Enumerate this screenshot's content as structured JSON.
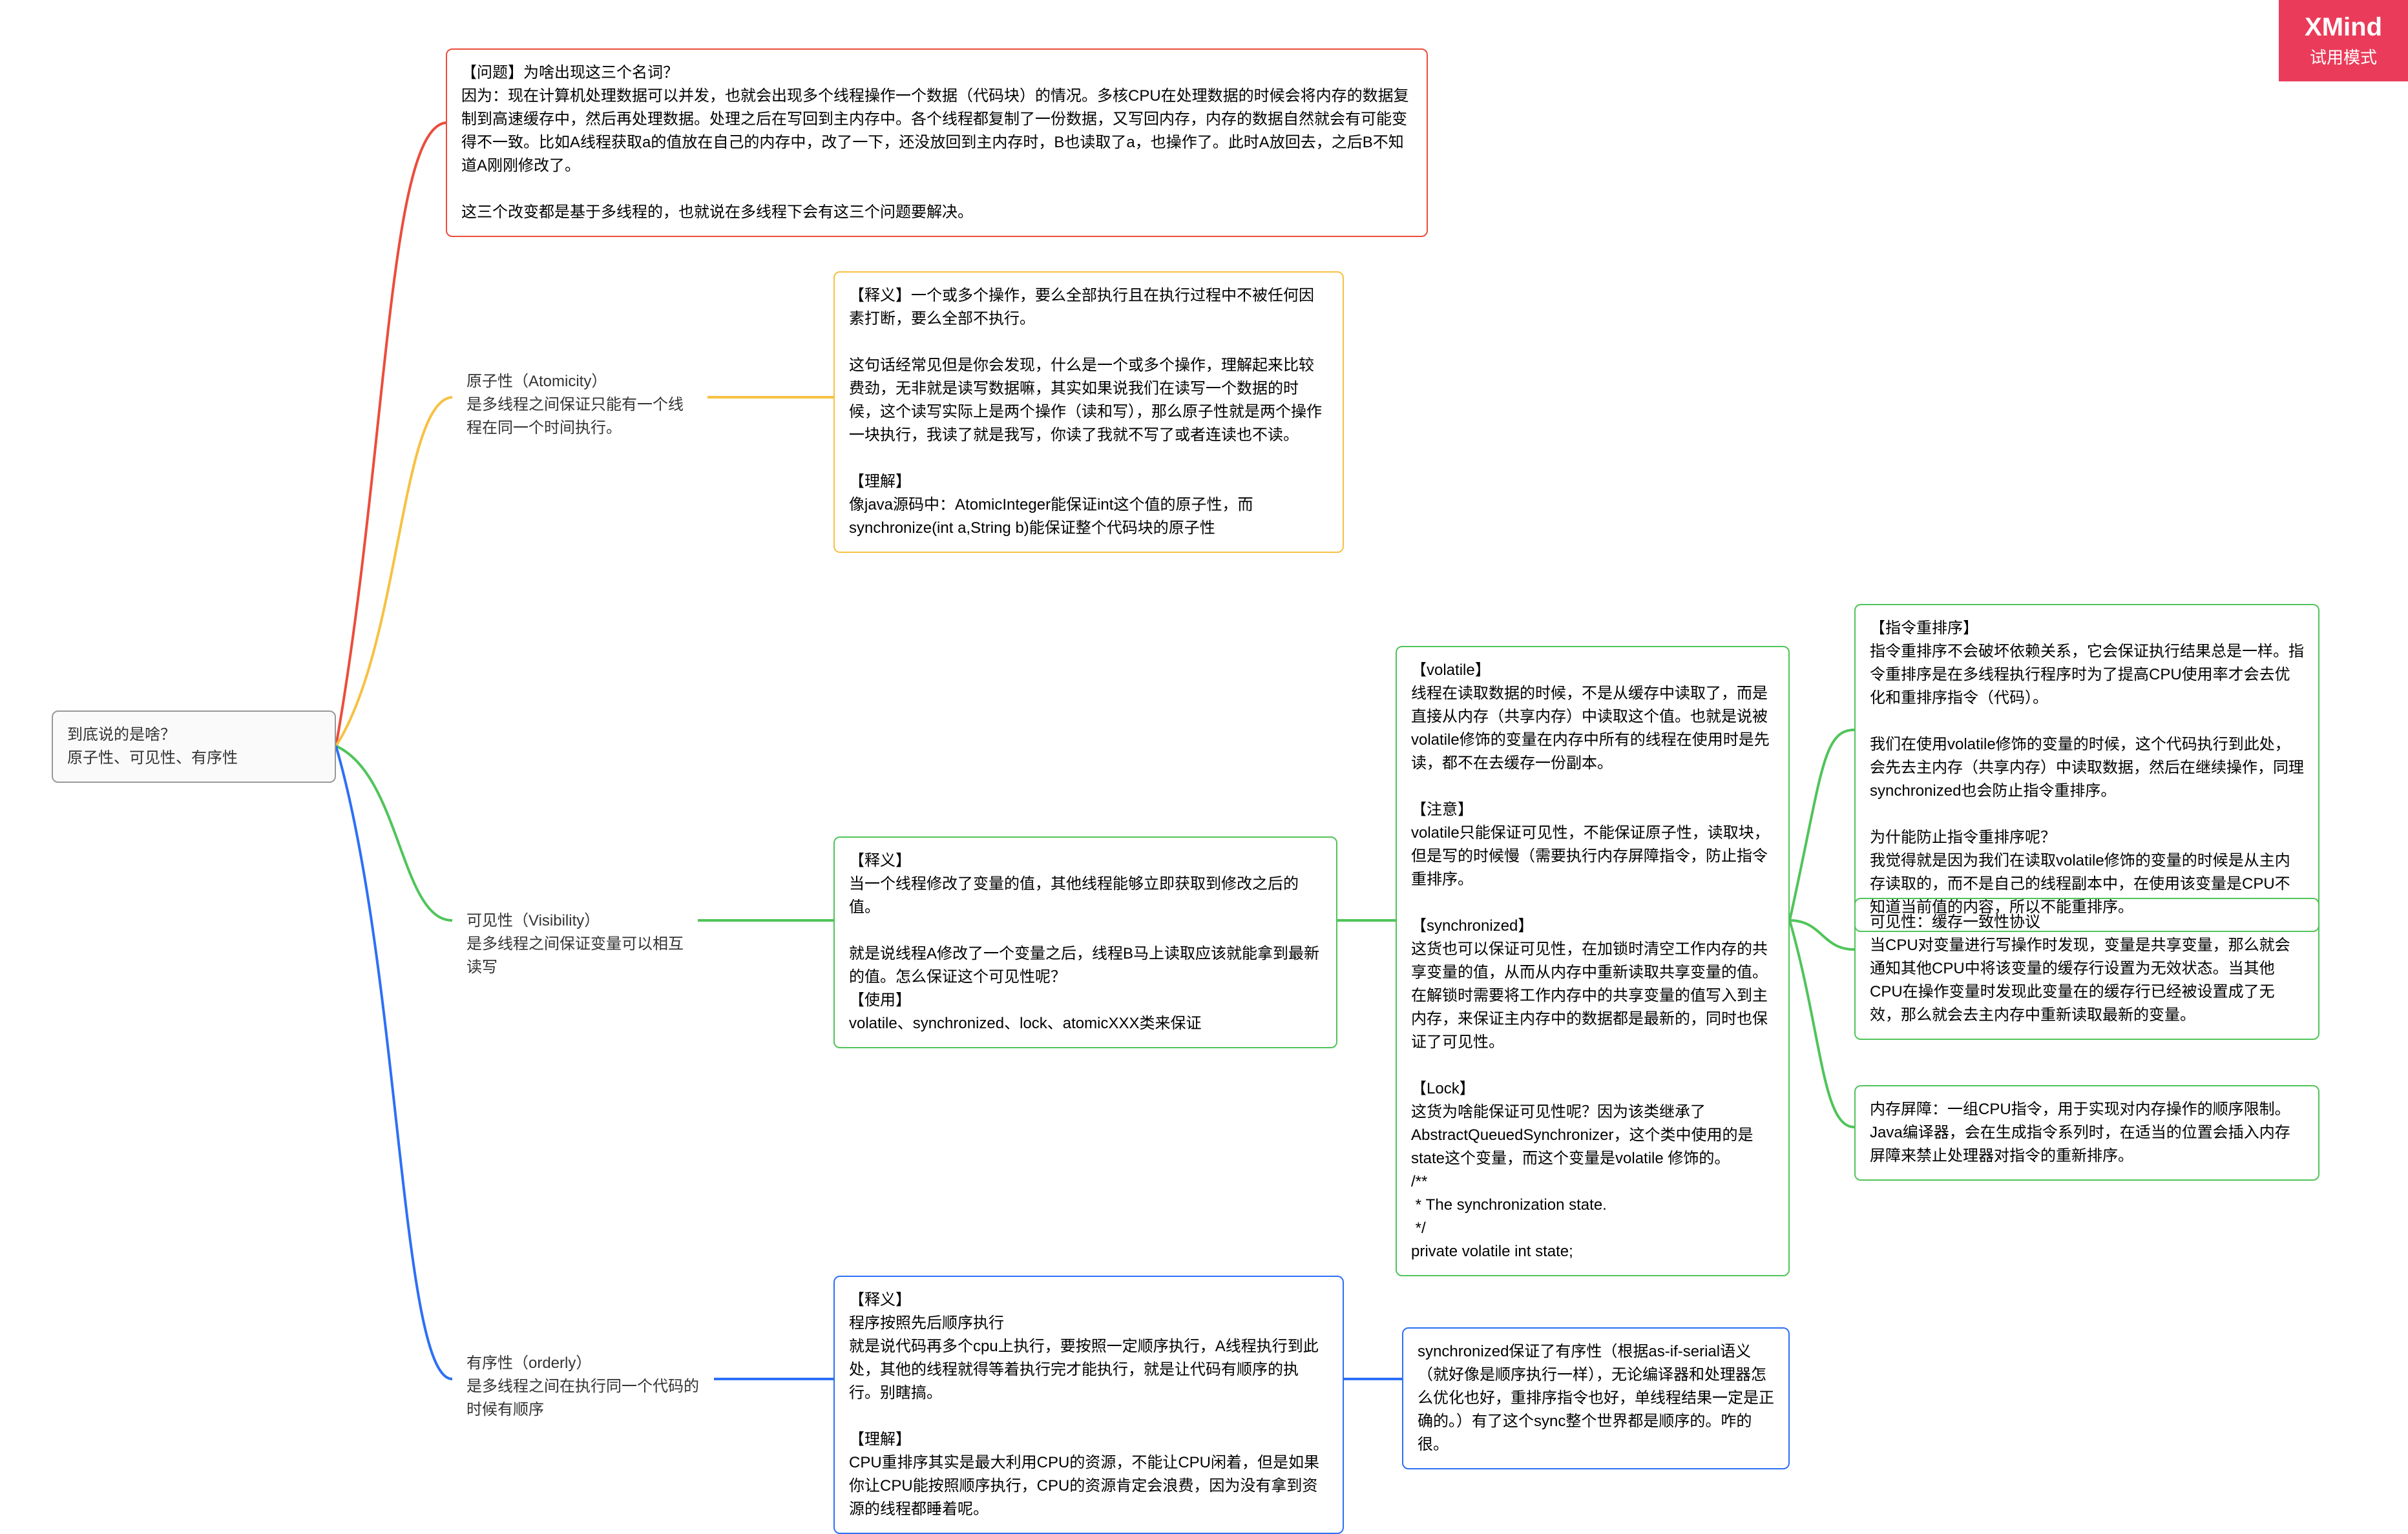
{
  "watermark": {
    "brand": "XMind",
    "sub": "试用模式"
  },
  "root": "到底说的是啥？\n原子性、可见性、有序性",
  "problem": "【问题】为啥出现这三个名词？\n因为：现在计算机处理数据可以并发，也就会出现多个线程操作一个数据（代码块）的情况。多核CPU在处理数据的时候会将内存的数据复制到高速缓存中，然后再处理数据。处理之后在写回到主内存中。各个线程都复制了一份数据，又写回内存，内存的数据自然就会有可能变得不一致。比如A线程获取a的值放在自己的内存中，改了一下，还没放回到主内存时，B也读取了a，也操作了。此时A放回去，之后B不知道A刚刚修改了。\n\n这三个改变都是基于多线程的，也就说在多线程下会有这三个问题要解决。",
  "atomicity": {
    "label": "原子性（Atomicity）\n是多线程之间保证只能有一个线程在同一个时间执行。",
    "desc": "【释义】一个或多个操作，要么全部执行且在执行过程中不被任何因素打断，要么全部不执行。\n\n这句话经常见但是你会发现，什么是一个或多个操作，理解起来比较费劲，无非就是读写数据嘛，其实如果说我们在读写一个数据的时候，这个读写实际上是两个操作（读和写），那么原子性就是两个操作一块执行，我读了就是我写，你读了我就不写了或者连读也不读。\n\n【理解】\n像java源码中：AtomicInteger能保证int这个值的原子性，而synchronize(int a,String b)能保证整个代码块的原子性"
  },
  "visibility": {
    "label": "可见性（Visibility）\n是多线程之间保证变量可以相互读写",
    "desc": "【释义】\n当一个线程修改了变量的值，其他线程能够立即获取到修改之后的值。\n\n就是说线程A修改了一个变量之后，线程B马上读取应该就能拿到最新的值。怎么保证这个可见性呢？\n【使用】\nvolatile、synchronized、lock、atomicXXX类来保证",
    "volatile": "【volatile】\n线程在读取数据的时候，不是从缓存中读取了，而是直接从内存（共享内存）中读取这个值。也就是说被volatile修饰的变量在内存中所有的线程在使用时是先读，都不在去缓存一份副本。\n\n【注意】\nvolatile只能保证可见性，不能保证原子性，读取块，但是写的时候慢（需要执行内存屏障指令，防止指令重排序。\n\n【synchronized】\n这货也可以保证可见性，在加锁时清空工作内存的共享变量的值，从而从内存中重新读取共享变量的值。在解锁时需要将工作内存中的共享变量的值写入到主内存，来保证主内存中的数据都是最新的，同时也保证了可见性。\n\n【Lock】\n这货为啥能保证可见性呢？因为该类继承了AbstractQueuedSynchronizer，这个类中使用的是state这个变量，而这个变量是volatile 修饰的。\n/**\n * The synchronization state.\n */\nprivate volatile int state;",
    "reorder": "【指令重排序】\n指令重排序不会破坏依赖关系，它会保证执行结果总是一样。指令重排序是在多线程执行程序时为了提高CPU使用率才会去优化和重排序指令（代码）。\n\n我们在使用volatile修饰的变量的时候，这个代码执行到此处，会先去主内存（共享内存）中读取数据，然后在继续操作，同理synchronized也会防止指令重排序。\n\n为什能防止指令重排序呢？\n我觉得就是因为我们在读取volatile修饰的变量的时候是从主内存读取的，而不是自己的线程副本中，在使用该变量是CPU不知道当前值的内容，所以不能重排序。",
    "cache": "可见性：缓存一致性协议\n当CPU对变量进行写操作时发现，变量是共享变量，那么就会通知其他CPU中将该变量的缓存行设置为无效状态。当其他CPU在操作变量时发现此变量在的缓存行已经被设置成了无效，那么就会去主内存中重新读取最新的变量。",
    "barrier": "内存屏障：一组CPU指令，用于实现对内存操作的顺序限制。\nJava编译器，会在生成指令系列时，在适当的位置会插入内存屏障来禁止处理器对指令的重新排序。"
  },
  "orderly": {
    "label": "有序性（orderly）\n是多线程之间在执行同一个代码的时候有顺序",
    "desc": "【释义】\n程序按照先后顺序执行\n就是说代码再多个cpu上执行，要按照一定顺序执行，A线程执行到此处，其他的线程就得等着执行完才能执行，就是让代码有顺序的执行。别瞎搞。\n\n【理解】\nCPU重排序其实是最大利用CPU的资源，不能让CPU闲着，但是如果你让CPU能按照顺序执行，CPU的资源肯定会浪费，因为没有拿到资源的线程都睡着呢。",
    "sync": "synchronized保证了有序性（根据as-if-serial语义（就好像是顺序执行一样），无论编译器和处理器怎么优化也好，重排序指令也好，单线程结果一定是正确的。）有了这个sync整个世界都是顺序的。咋的很。"
  }
}
